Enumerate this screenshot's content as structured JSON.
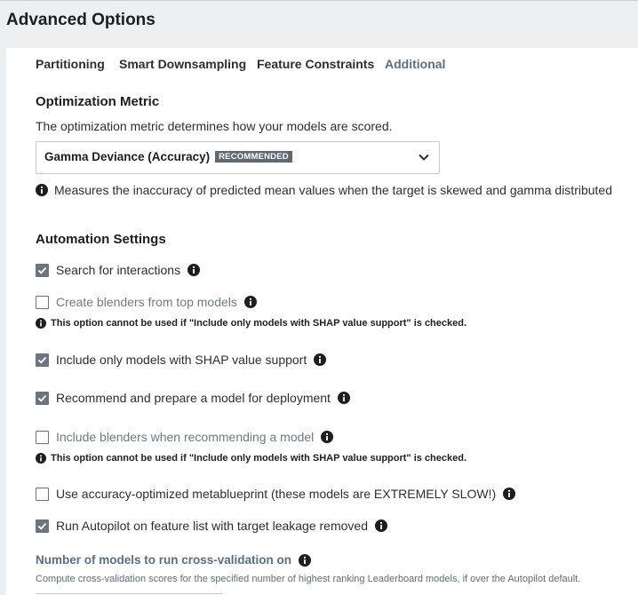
{
  "header": {
    "title": "Advanced Options"
  },
  "tabs": [
    {
      "label": "Partitioning",
      "active": false
    },
    {
      "label": "Smart Downsampling",
      "active": false
    },
    {
      "label": "Feature Constraints",
      "active": false
    },
    {
      "label": "Additional",
      "active": true
    }
  ],
  "optimization": {
    "heading": "Optimization Metric",
    "description": "The optimization metric determines how your models are scored.",
    "selected": "Gamma Deviance (Accuracy)",
    "badge": "RECOMMENDED",
    "info": "Measures the inaccuracy of predicted mean values when the target is skewed and gamma distributed"
  },
  "automation": {
    "heading": "Automation Settings",
    "options": [
      {
        "label": "Search for interactions",
        "checked": true,
        "disabled": false,
        "note": ""
      },
      {
        "label": "Create blenders from top models",
        "checked": false,
        "disabled": true,
        "note": "This option cannot be used if \"Include only models with SHAP value support\" is checked."
      },
      {
        "label": "Include only models with SHAP value support",
        "checked": true,
        "disabled": false,
        "note": ""
      },
      {
        "label": "Recommend and prepare a model for deployment",
        "checked": true,
        "disabled": false,
        "note": ""
      },
      {
        "label": "Include blenders when recommending a model",
        "checked": false,
        "disabled": true,
        "note": "This option cannot be used if \"Include only models with SHAP value support\" is checked."
      },
      {
        "label": "Use accuracy-optimized metablueprint (these models are EXTREMELY SLOW!)",
        "checked": false,
        "disabled": false,
        "note": ""
      },
      {
        "label": "Run Autopilot on feature list with target leakage removed",
        "checked": true,
        "disabled": false,
        "note": ""
      }
    ]
  },
  "cross_validation": {
    "heading": "Number of models to run cross-validation on",
    "description": "Compute cross-validation scores for the specified number of highest ranking Leaderboard models, if over the Autopilot default."
  },
  "colors": {
    "active_tab": "#5b6e82",
    "checkbox_checked": "#6c757f",
    "badge_bg": "#5f6873",
    "panel_bg": "#eeeff1"
  },
  "icons": {
    "info": "info-circle-icon",
    "chevron": "chevron-down-icon",
    "check": "check-icon"
  }
}
